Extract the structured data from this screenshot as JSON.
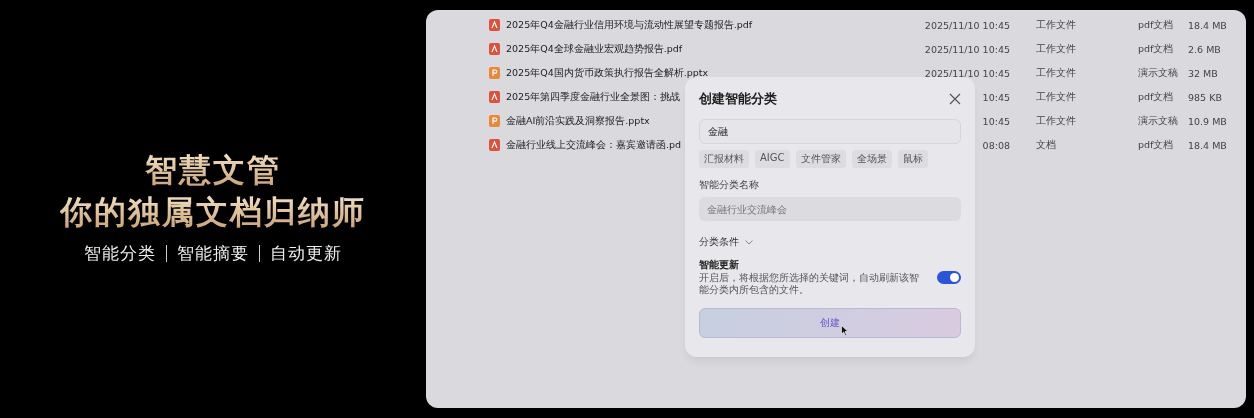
{
  "promo": {
    "title": "智慧文管",
    "subtitle": "你的独属文档归纳师",
    "features": [
      "智能分类",
      "智能摘要",
      "自动更新"
    ]
  },
  "files": [
    {
      "kind": "pdf",
      "name": "2025年Q4金融行业信用环境与流动性展望专题报告.pdf",
      "modified": "2025/11/10 10:45",
      "folder": "工作文件",
      "type": "pdf文档",
      "size": "18.4 MB"
    },
    {
      "kind": "pdf",
      "name": "2025年Q4全球金融业宏观趋势报告.pdf",
      "modified": "2025/11/10 10:45",
      "folder": "工作文件",
      "type": "pdf文档",
      "size": "2.6 MB"
    },
    {
      "kind": "pptx",
      "name": "2025年Q4国内货币政策执行报告全解析.pptx",
      "modified": "2025/11/10 10:45",
      "folder": "工作文件",
      "type": "演示文稿",
      "size": "32 MB"
    },
    {
      "kind": "pdf",
      "name": "2025年第四季度金融行业全景图：挑战",
      "modified": "10:45",
      "folder": "工作文件",
      "type": "pdf文档",
      "size": "985 KB"
    },
    {
      "kind": "pptx",
      "name": "金融AI前沿实践及洞察报告.pptx",
      "modified": "10:45",
      "folder": "工作文件",
      "type": "演示文稿",
      "size": "10.9 MB"
    },
    {
      "kind": "pdf",
      "name": "金融行业线上交流峰会：嘉宾邀请函.pd",
      "modified": "08:08",
      "folder": "文档",
      "type": "pdf文档",
      "size": "18.4 MB"
    }
  ],
  "dialog": {
    "title": "创建智能分类",
    "keyword_field": {
      "value": "金融"
    },
    "tags": [
      "汇报材料",
      "AIGC",
      "文件管家",
      "全场景",
      "鼠标"
    ],
    "name_label": "智能分类名称",
    "name_field": {
      "placeholder": "金融行业交流峰会"
    },
    "conditions": {
      "label": "分类条件",
      "expanded": false
    },
    "smart_update": {
      "label": "智能更新",
      "description": "开启后，将根据您所选择的关键词，自动刷新该智能分类内所包含的文件。",
      "on": true
    },
    "create_button": "创建"
  }
}
